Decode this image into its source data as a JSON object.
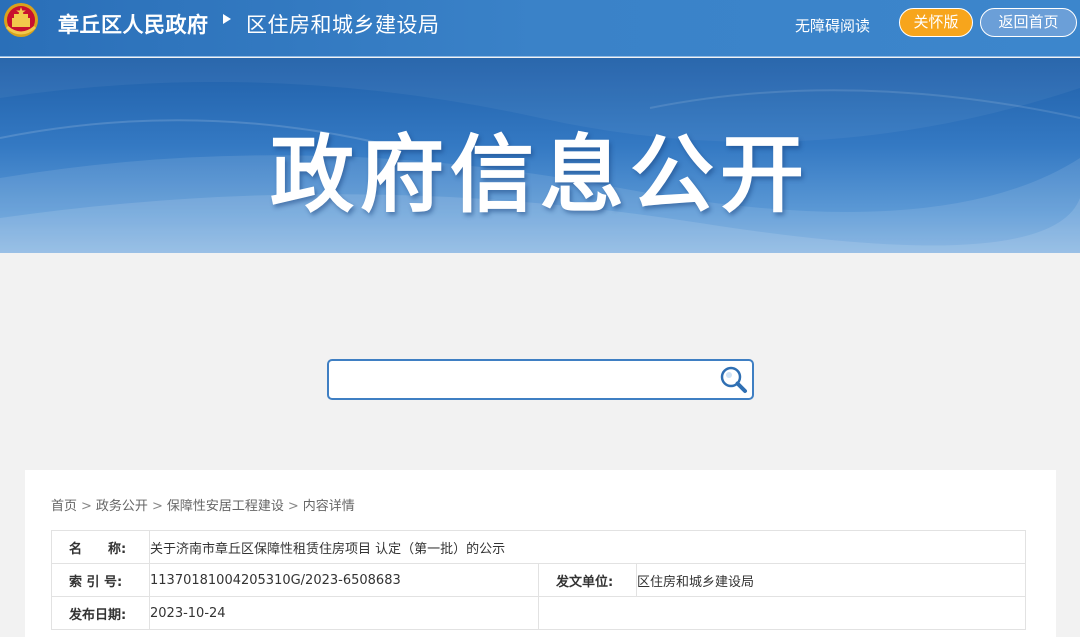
{
  "header": {
    "site_name": "章丘区人民政府",
    "dept_name": "区住房和城乡建设局",
    "accessible_reading": "无障碍阅读",
    "care_version": "关怀版",
    "back_home": "返回首页"
  },
  "banner": {
    "title": "政府信息公开"
  },
  "search": {
    "value": "",
    "placeholder": ""
  },
  "breadcrumb": [
    "首页",
    "政务公开",
    "保障性安居工程建设",
    "内容详情"
  ],
  "breadcrumb_separator": ">",
  "info": {
    "name_label": "名　　称:",
    "name_value": "关于济南市章丘区保障性租赁住房项目 认定（第一批）的公示",
    "index_label": "索 引 号:",
    "index_value": "11370181004205310G/2023-6508683",
    "issuer_label": "发文单位:",
    "issuer_value": "区住房和城乡建设局",
    "date_label": "发布日期:",
    "date_value": "2023-10-24"
  },
  "colors": {
    "header_blue": "#2a6fb8",
    "care_orange": "#f7a51c",
    "search_border": "#3f7fc3"
  }
}
